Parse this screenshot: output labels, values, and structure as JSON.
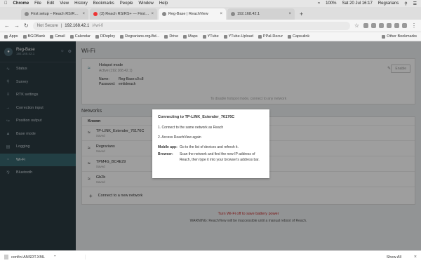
{
  "menubar": {
    "app": "Chrome",
    "items": [
      "File",
      "Edit",
      "View",
      "History",
      "Bookmarks",
      "People",
      "Window",
      "Help"
    ],
    "battery": "100%",
    "clock": "Sat 20 Jul 16:17",
    "user": "Regrarians"
  },
  "tabs": [
    {
      "label": "First setup – Reach RS/RS+ do…",
      "active": false,
      "icon": "doc-icon"
    },
    {
      "label": "(3) Reach RS/RS+ — First upd…",
      "active": false,
      "icon": "youtube-icon"
    },
    {
      "label": "Reg-Base | ReachView",
      "active": true,
      "icon": "reach-icon"
    },
    {
      "label": "192.168.42.1",
      "active": false,
      "icon": "globe-icon"
    }
  ],
  "address": {
    "security": "Not Secure",
    "url": "192.168.42.1",
    "path": "/#wi-fi"
  },
  "bookmarks": [
    "Apps",
    "BGOBank",
    "Gmail",
    "Calendar",
    "DDeploy",
    "Regrarians.org/Ad...",
    "Drive",
    "Maps",
    "YTube",
    "YTube-Upload",
    "PPal-Recur",
    "Capsulink"
  ],
  "bookmarks_other": "Other Bookmarks",
  "device": {
    "name": "Reg-Base",
    "ip": "192.168.42.1"
  },
  "nav": [
    {
      "label": "Status",
      "icon": "pulse-icon",
      "active": false
    },
    {
      "label": "Survey",
      "icon": "pin-icon",
      "active": false
    },
    {
      "label": "RTK settings",
      "icon": "sliders-icon",
      "active": false
    },
    {
      "label": "Correction input",
      "icon": "arrow-in-icon",
      "active": false
    },
    {
      "label": "Position output",
      "icon": "arrow-out-icon",
      "active": false
    },
    {
      "label": "Base mode",
      "icon": "base-icon",
      "active": false
    },
    {
      "label": "Logging",
      "icon": "log-icon",
      "active": false
    },
    {
      "label": "Wi-Fi",
      "icon": "wifi-icon",
      "active": true
    },
    {
      "label": "Bluetooth",
      "icon": "bluetooth-icon",
      "active": false
    }
  ],
  "page_title": "Wi-Fi",
  "hotspot": {
    "title": "Hotspot mode",
    "status": "Active (192.168.42.1)",
    "name_label": "Name:",
    "name_value": "Reg-Base:c0:c8",
    "password_label": "Password:",
    "password_value": "emlidreach",
    "enable_label": "Enable",
    "hint": "To disable hotspot mode, connect to any network"
  },
  "networks_title": "Networks",
  "known_label": "Known",
  "networks": [
    {
      "name": "TP-LINK_Extender_76176C",
      "status": "Saved"
    },
    {
      "name": "Regrarians",
      "status": "Saved"
    },
    {
      "name": "TPM4G_BC4E29",
      "status": "Saved"
    },
    {
      "name": "Gb2b",
      "status": "Saved"
    }
  ],
  "connect_new": "Connect to a new network",
  "warning": "Turn Wi-Fi off to save battery power",
  "warning_detail": "WARNING: ReachView will be inaccessible until a manual reboot of Reach.",
  "modal": {
    "title": "Connecting to TP-LINK_Extender_76176C",
    "step1": "1. Connect to the same network as Reach",
    "step2": "2. Access ReachView again",
    "mobile_label": "Mobile app:",
    "mobile_text": "Go to the list of devices and refresh it.",
    "browser_label": "Browser:",
    "browser_text": "Scan the network and find the new IP address of Reach, then type it into your browser's address bar."
  },
  "download": {
    "file": "confini ANSDT.XML",
    "show_all": "Show All"
  },
  "colors": {
    "sidebar": "#2b3a42",
    "active_nav": "#37676f",
    "warning": "#c62828"
  }
}
